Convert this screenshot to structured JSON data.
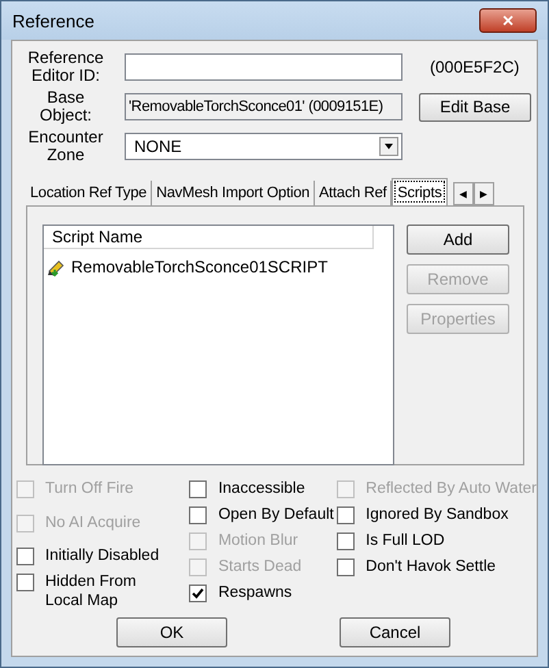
{
  "window": {
    "title": "Reference",
    "close_label": "✕"
  },
  "fields": [
    {
      "kind": "text",
      "label": "Reference Editor ID:",
      "aside": "(000E5F2C)"
    },
    {
      "kind": "readonly",
      "label": "Base Object:",
      "value": "'RemovableTorchSconce01' (0009151E)",
      "button": "Edit Base"
    },
    {
      "kind": "combo",
      "label": "Encounter Zone",
      "value": "NONE"
    }
  ],
  "tabs": [
    {
      "label": "Location Ref Type",
      "selected": false
    },
    {
      "label": "NavMesh Import Option",
      "selected": false
    },
    {
      "label": "Attach Ref",
      "selected": false
    },
    {
      "label": "Scripts",
      "selected": true
    }
  ],
  "tab_scroll": [
    "◀",
    "▶"
  ],
  "script_list": {
    "column": "Script Name",
    "rows": [
      "RemovableTorchSconce01SCRIPT"
    ]
  },
  "script_buttons": [
    {
      "label": "Add",
      "disabled": false
    },
    {
      "label": "Remove",
      "disabled": true
    },
    {
      "label": "Properties",
      "disabled": true
    }
  ],
  "flag_columns": [
    [
      {
        "label": "Turn Off Fire",
        "checked": false,
        "disabled": true
      },
      {
        "label": "No AI Acquire",
        "checked": false,
        "disabled": true
      },
      {
        "label": "Initially Disabled",
        "checked": false,
        "disabled": false
      },
      {
        "label": "Hidden From Local Map",
        "checked": false,
        "disabled": false
      }
    ],
    [
      {
        "label": "Inaccessible",
        "checked": false,
        "disabled": false
      },
      {
        "label": "Open By Default",
        "checked": false,
        "disabled": false
      },
      {
        "label": "Motion Blur",
        "checked": false,
        "disabled": true
      },
      {
        "label": "Starts Dead",
        "checked": false,
        "disabled": true
      },
      {
        "label": "Respawns",
        "checked": true,
        "disabled": false
      }
    ],
    [
      {
        "label": "Reflected By Auto Water",
        "checked": false,
        "disabled": true
      },
      {
        "label": "Ignored By Sandbox",
        "checked": false,
        "disabled": false
      },
      {
        "label": "Is Full LOD",
        "checked": false,
        "disabled": false
      },
      {
        "label": "Don't Havok Settle",
        "checked": false,
        "disabled": false
      }
    ]
  ],
  "buttons": [
    "OK",
    "Cancel"
  ]
}
